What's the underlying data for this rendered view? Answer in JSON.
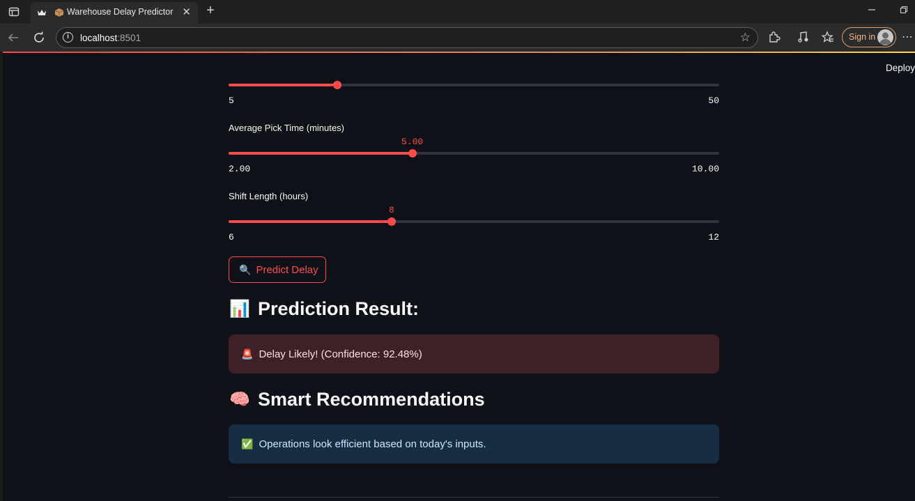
{
  "browser": {
    "tab_title": "Warehouse Delay Predictor",
    "tab_close": "✕",
    "new_tab": "+",
    "url_host": "localhost",
    "url_port": ":8501",
    "signin_label": "Sign in"
  },
  "app": {
    "deploy_label": "Deploy",
    "sliders": [
      {
        "label": "",
        "min_label": "5",
        "max_label": "50",
        "value": 18,
        "fraction": 0.222
      },
      {
        "label": "Average Pick Time (minutes)",
        "value_label": "5.00",
        "min_label": "2.00",
        "max_label": "10.00",
        "value": 5.0,
        "fraction": 0.375
      },
      {
        "label": "Shift Length (hours)",
        "value_label": "8",
        "min_label": "6",
        "max_label": "12",
        "value": 8,
        "fraction": 0.333
      }
    ],
    "predict_button": {
      "emoji": "🔍",
      "label": "Predict Delay"
    },
    "result_heading": {
      "emoji": "📊",
      "text": "Prediction Result:"
    },
    "result_alert": {
      "emoji": "🚨",
      "text": "Delay Likely! (Confidence: 92.48%)"
    },
    "recommend_heading": {
      "emoji": "🧠",
      "text": "Smart Recommendations"
    },
    "recommend_alert": {
      "emoji": "✅",
      "text": "Operations look efficient based on today's inputs."
    }
  },
  "colors": {
    "accent": "#ff4b4b",
    "background": "#0e1117",
    "error_bg": "#3e2127",
    "info_bg": "#172d43"
  }
}
